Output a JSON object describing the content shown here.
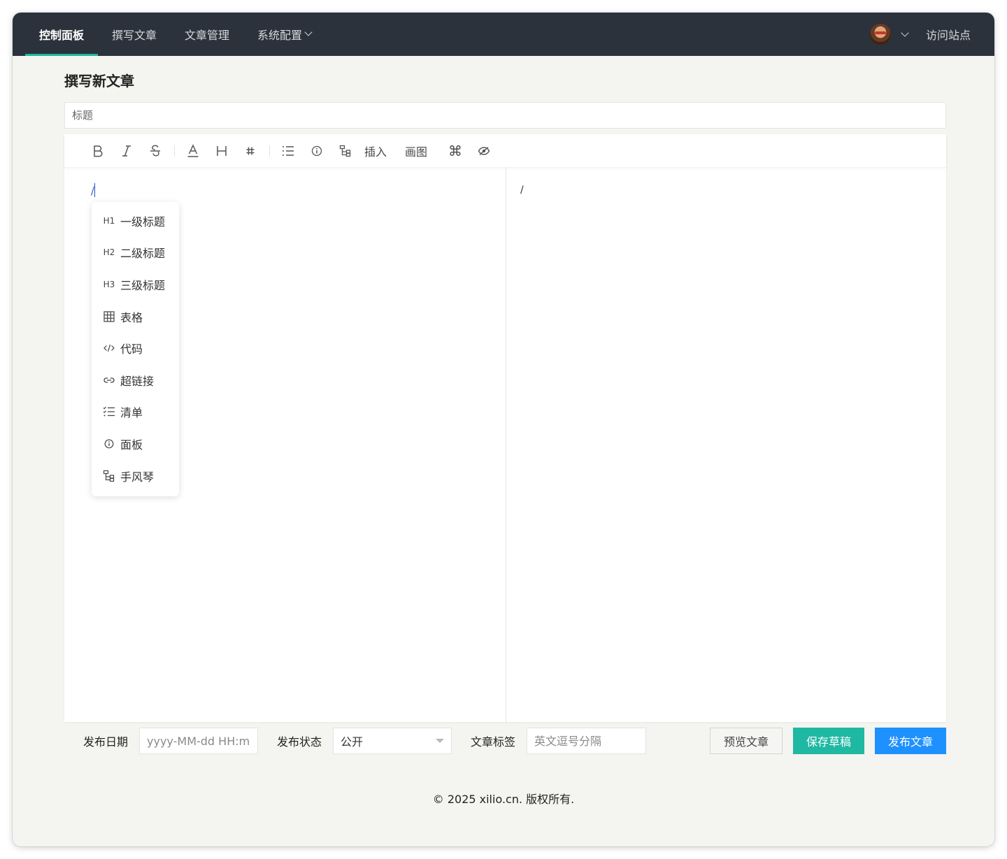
{
  "nav": {
    "items": [
      {
        "label": "控制面板",
        "active": true
      },
      {
        "label": "撰写文章",
        "active": false
      },
      {
        "label": "文章管理",
        "active": false
      },
      {
        "label": "系统配置",
        "active": false,
        "dropdown": true
      }
    ],
    "visit_site": "访问站点"
  },
  "page": {
    "title": "撰写新文章",
    "title_input_placeholder": "标题"
  },
  "toolbar": {
    "buttons": [
      {
        "icon": "bold-icon",
        "glyph": "B"
      },
      {
        "icon": "italic-icon",
        "glyph": "I"
      },
      {
        "icon": "strikethrough-icon",
        "glyph": "S"
      },
      {
        "icon": "font-color-icon",
        "glyph": "A"
      },
      {
        "icon": "heading-icon",
        "glyph": "H"
      },
      {
        "icon": "hashtag-icon",
        "glyph": "#"
      },
      {
        "icon": "list-icon",
        "glyph": "☰"
      },
      {
        "icon": "info-icon",
        "glyph": "ⓘ"
      },
      {
        "icon": "accordion-icon",
        "glyph": "⊏"
      }
    ],
    "insert_label": "插入",
    "draw_label": "画图",
    "command_glyph": "⌘",
    "preview_toggle_icon": "eye-icon"
  },
  "editor": {
    "content": "/",
    "preview_content": "/"
  },
  "slash_menu": {
    "items": [
      {
        "icon": "H1",
        "label": "一级标题"
      },
      {
        "icon": "H2",
        "label": "二级标题"
      },
      {
        "icon": "H3",
        "label": "三级标题"
      },
      {
        "icon": "table-icon",
        "label": "表格"
      },
      {
        "icon": "code-icon",
        "label": "代码"
      },
      {
        "icon": "link-icon",
        "label": "超链接"
      },
      {
        "icon": "checklist-icon",
        "label": "清单"
      },
      {
        "icon": "info-icon",
        "label": "面板"
      },
      {
        "icon": "accordion-icon",
        "label": "手风琴"
      }
    ]
  },
  "bottom": {
    "date_label": "发布日期",
    "date_placeholder": "yyyy-MM-dd HH:mm",
    "status_label": "发布状态",
    "status_value": "公开",
    "tags_label": "文章标签",
    "tags_placeholder": "英文逗号分隔",
    "preview_button": "预览文章",
    "save_draft_button": "保存草稿",
    "publish_button": "发布文章"
  },
  "footer": {
    "text": "© 2025 xilio.cn. 版权所有."
  },
  "colors": {
    "nav_bg": "#2b323b",
    "accent_teal": "#1fb8a2",
    "accent_blue": "#1e90ff",
    "page_bg": "#f4f4f1"
  }
}
